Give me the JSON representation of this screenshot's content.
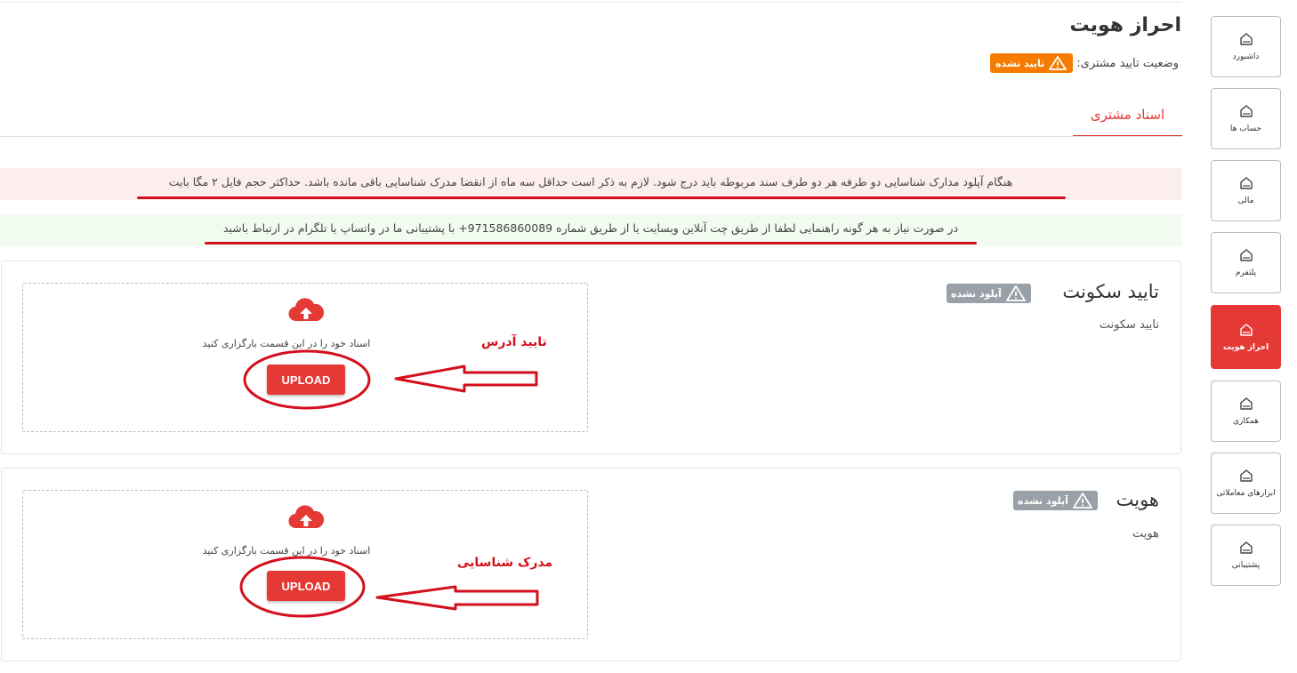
{
  "colors": {
    "accent": "#e53935",
    "warning": "#f57c00",
    "muted_badge": "#9aa0a8",
    "annotation": "#d3101c"
  },
  "sidebar": {
    "items": [
      {
        "label": "داشبورد",
        "icon": "home-icon"
      },
      {
        "label": "حساب ها",
        "icon": "home-icon"
      },
      {
        "label": "مالی",
        "icon": "home-icon"
      },
      {
        "label": "پلتفرم",
        "icon": "home-icon"
      },
      {
        "label": "احراز هویت",
        "icon": "home-icon",
        "active": true
      },
      {
        "label": "همکاری",
        "icon": "home-icon"
      },
      {
        "label": "ابزارهای معاملاتی",
        "icon": "home-icon"
      },
      {
        "label": "پشتیبانی",
        "icon": "home-icon"
      }
    ]
  },
  "header": {
    "title": "احراز هویت",
    "status_label": "وضعیت تایید مشتری:",
    "status_badge": "تایید نشده",
    "status_icon": "warning-icon"
  },
  "tabs": [
    {
      "label": "اسناد مشتری",
      "active": true
    }
  ],
  "alerts": {
    "info": "هنگام آپلود مدارک شناسایی دو طرفه هر دو طرف سند مربوطه باید درج شود. لازم به ذکر است حداقل سه ماه از انقضا مدرک شناسایی باقی مانده باشد. حداکثر حجم فایل ۲ مگا بایت",
    "support": "در صورت نیاز به هر گونه راهنمایی لطفا از طریق چت آنلاین وبسایت یا از طریق شماره 971586860089+ با پشتیبانی ما در واتساپ یا تلگرام در ارتباط باشید"
  },
  "documents": [
    {
      "title": "تایید سکونت",
      "subtitle": "تایید سکونت",
      "badge": "آپلود نشده",
      "dropzone_text": "اسناد خود را در این قسمت بارگزاری کنید",
      "upload_label": "UPLOAD",
      "annotation": "تایید آدرس"
    },
    {
      "title": "هویت",
      "subtitle": "هویت",
      "badge": "آپلود نشده",
      "dropzone_text": "اسناد خود را در این قسمت بارگزاری کنید",
      "upload_label": "UPLOAD",
      "annotation": "مدرک شناسایی"
    }
  ]
}
